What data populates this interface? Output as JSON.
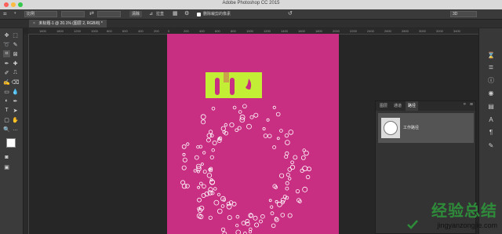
{
  "window": {
    "title": "Adobe Photoshop CC 2015"
  },
  "options_bar": {
    "style_value": "比例",
    "btn_clear": "清除",
    "btn_straighten": "拉直",
    "delete_cropped_label": "删除裁剪的像素",
    "workspace_value": "3D"
  },
  "document_tab": {
    "label": "未标题-1 @ 20.1% (图层 2, RGB/8) *"
  },
  "ruler_ticks": [
    "400",
    "1600",
    "1800",
    "1200",
    "1000",
    "800",
    "600",
    "400",
    "200",
    "0",
    "200",
    "400",
    "600",
    "800",
    "1000",
    "1200",
    "1400",
    "1600",
    "1800",
    "2000",
    "2200",
    "2400",
    "2600",
    "2800",
    "3000",
    "3200",
    "3400"
  ],
  "paths_panel": {
    "tabs": [
      "图层",
      "通道",
      "路径"
    ],
    "active_tab": "路径",
    "items": [
      {
        "name": "工作路径"
      }
    ]
  },
  "watermark": {
    "cn": "经验总结",
    "url": "jingyanzongjie.com"
  },
  "colors": {
    "canvas": "#c82e81",
    "text_block": "#c2ee35",
    "ui_dark": "#262626",
    "watermark_green": "#2e8b3a",
    "watermark_red": "#d6312f"
  }
}
